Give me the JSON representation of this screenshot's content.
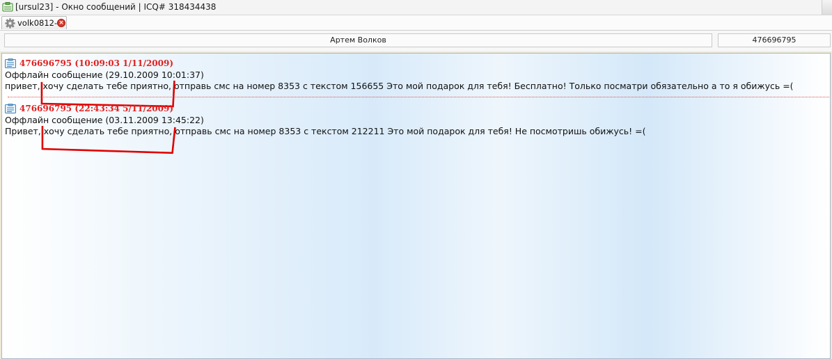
{
  "window": {
    "title": "[ursul23] - Окно сообщений | ICQ# 318434438"
  },
  "tabs": [
    {
      "label": "volk0812-",
      "close_glyph": "×"
    }
  ],
  "contact": {
    "name": "Артем Волков",
    "uin": "476696795"
  },
  "messages": [
    {
      "sender_line": "476696795 (10:09:03 1/11/2009)",
      "offline_line": "Оффлайн сообщение (29.10.2009 10:01:37)",
      "text_before": "привет,",
      "text_highlight": "хочу сделать тебе приятно,",
      "text_after": "отправь смс на номер 8353 с текстом 156655 Это мой подарок для тебя! Бесплатно! Только посматри обязательно а то я обижусь =("
    },
    {
      "sender_line": "476696795 (22:43:34 5/11/2009)",
      "offline_line": "Оффлайн сообщение (03.11.2009 13:45:22)",
      "text_before": "Привет,",
      "text_highlight": "хочу сделать тебе приятно,",
      "text_after": "отправь смс на номер 8353 с текстом 212211 Это мой подарок для тебя! Не посмотришь обижусь! =("
    }
  ],
  "icons": {
    "app": "icq-message-icon",
    "tab": "gear-icon",
    "tab_close": "close-icon",
    "message": "message-card-icon"
  },
  "colors": {
    "sender": "#e02020",
    "highlight_mark": "#e00000",
    "message_bg_light": "#ffffff",
    "message_bg_blue": "#d8eafa"
  }
}
